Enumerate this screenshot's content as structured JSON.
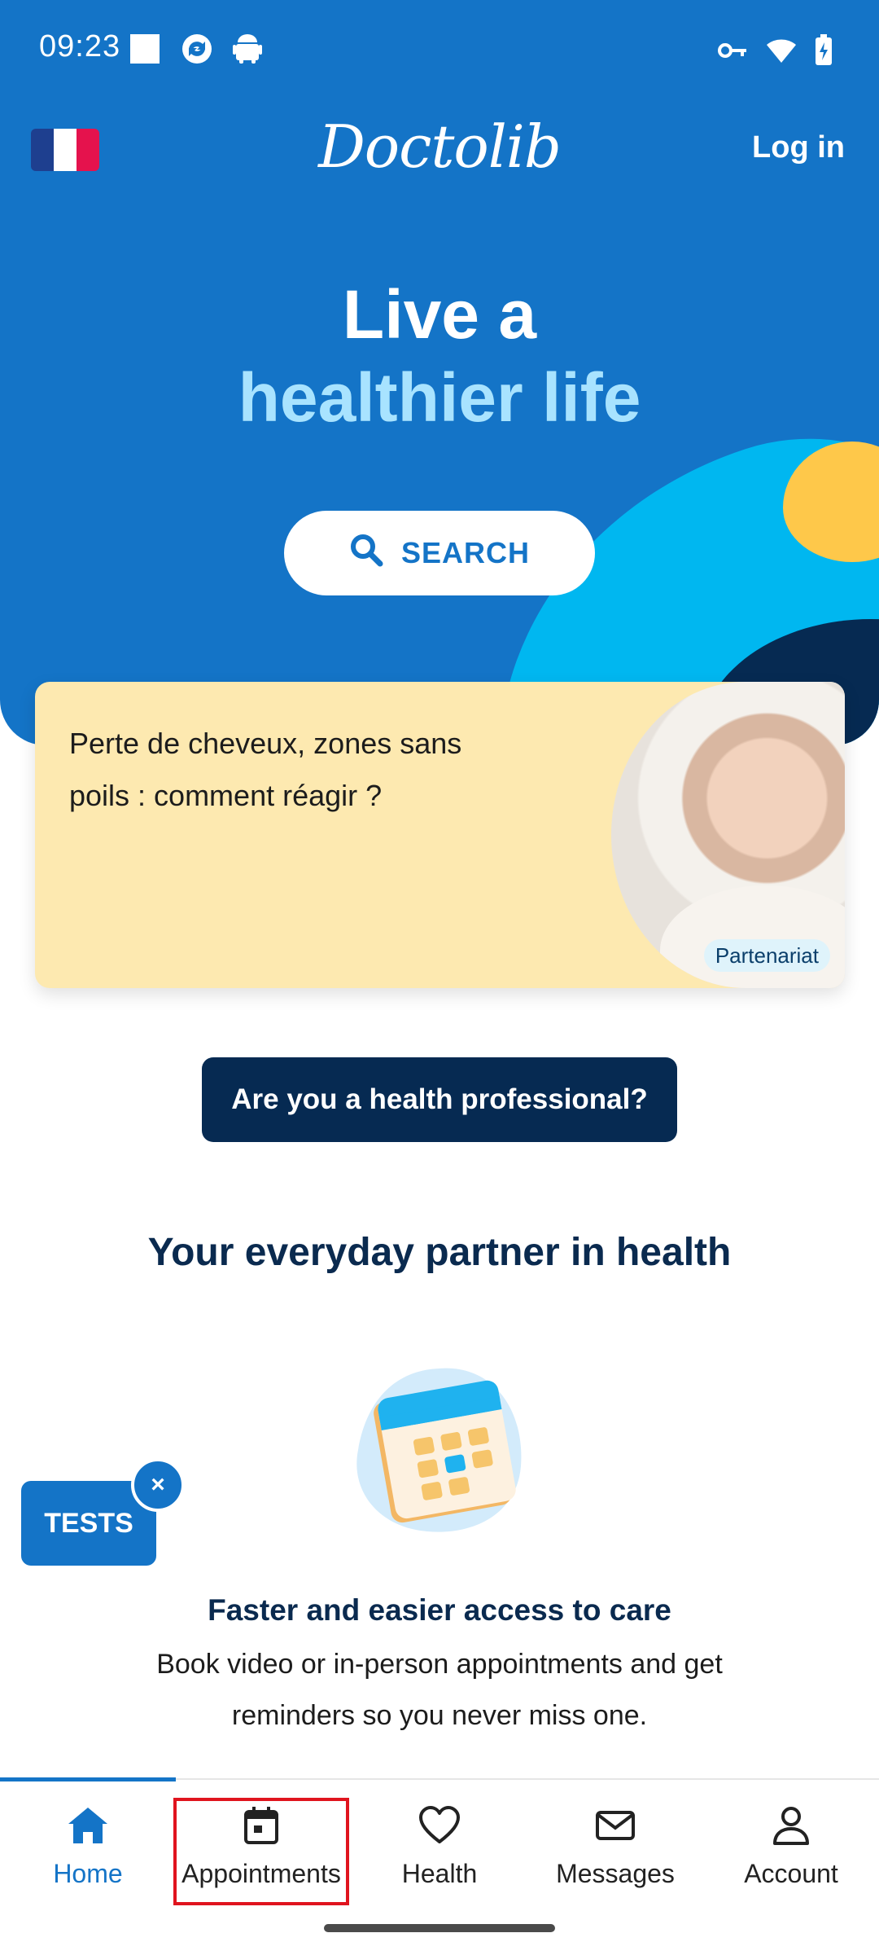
{
  "status_bar": {
    "time": "09:23"
  },
  "header": {
    "logo_text": "Doctolib",
    "login_label": "Log in"
  },
  "hero": {
    "line1": "Live a",
    "line2": "healthier life",
    "search_label": "SEARCH"
  },
  "article_card": {
    "text": "Perte de cheveux, zones sans poils : comment réagir ?",
    "badge": "Partenariat"
  },
  "pro_button_label": "Are you a health professional?",
  "section_title": "Your everyday partner in health",
  "feature": {
    "title": "Faster and easier access to care",
    "description": "Book video or in-person appointments and get reminders so you never miss one."
  },
  "floating_tests": {
    "label": "TESTS",
    "close_glyph": "×"
  },
  "bottom_nav": {
    "items": [
      {
        "label": "Home",
        "icon": "home-icon"
      },
      {
        "label": "Appointments",
        "icon": "calendar-icon"
      },
      {
        "label": "Health",
        "icon": "heart-icon"
      },
      {
        "label": "Messages",
        "icon": "mail-icon"
      },
      {
        "label": "Account",
        "icon": "person-icon"
      }
    ]
  },
  "colors": {
    "brand_blue": "#1474c7",
    "navy": "#062a52",
    "light_blue_text": "#a8e3ff",
    "cyan_blob": "#00b7f0",
    "yellow_blob": "#fec84a",
    "card_bg": "#fde9b0",
    "highlight_red": "#e0141e"
  }
}
